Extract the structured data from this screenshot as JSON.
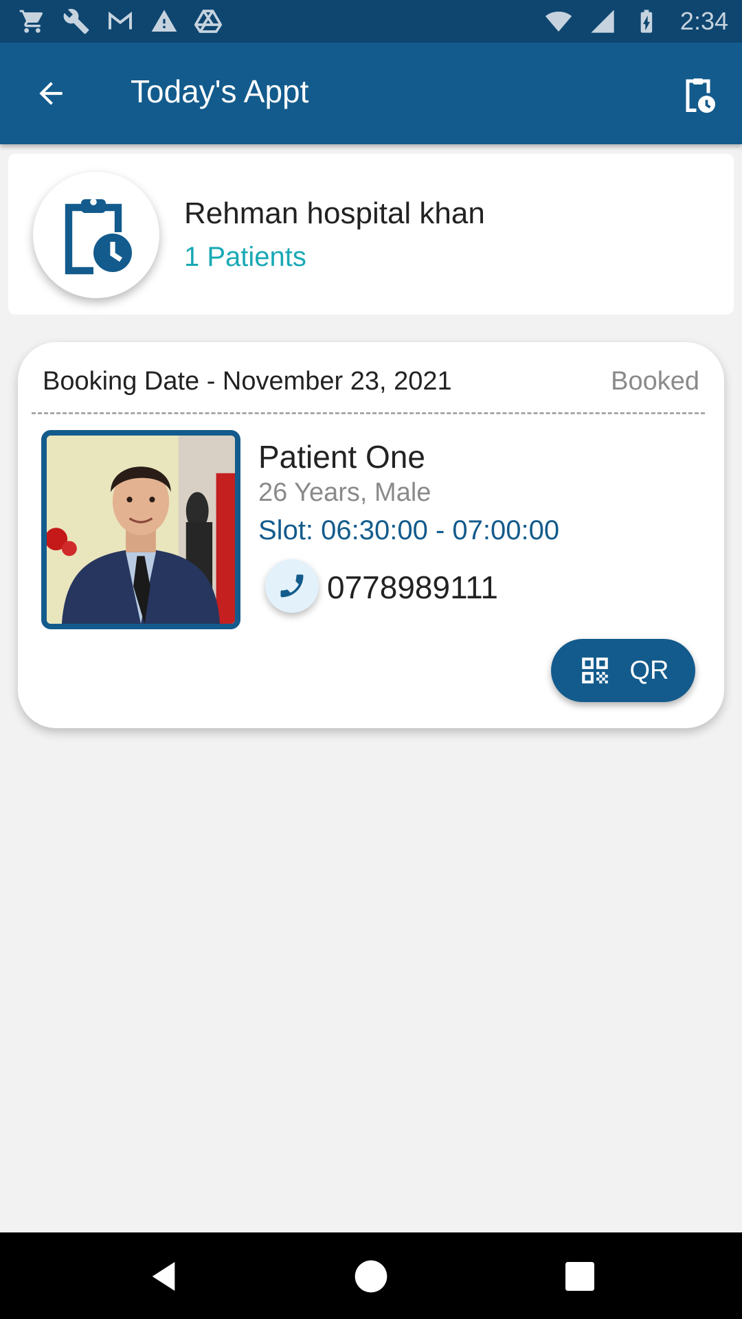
{
  "status_bar": {
    "time": "2:34",
    "left_icons": [
      "cart-icon",
      "wrench-icon",
      "gmail-icon",
      "warning-icon",
      "drive-icon"
    ],
    "right_icons": [
      "wifi-icon",
      "signal-icon",
      "battery-icon"
    ]
  },
  "app_bar": {
    "title": "Today's Appt",
    "back_icon": "arrow-back-icon",
    "action_icon": "clipboard-clock-icon"
  },
  "hospital": {
    "name": "Rehman hospital khan",
    "patients_count": "1 Patients",
    "icon": "clipboard-clock-icon"
  },
  "appointment": {
    "booking_date": "Booking Date - November 23, 2021",
    "status": "Booked",
    "patient_name": "Patient One",
    "patient_meta": "26 Years, Male",
    "slot": "Slot: 06:30:00 - 07:00:00",
    "phone": "0778989111",
    "qr_label": "QR"
  },
  "colors": {
    "status_bar": "#0e4670",
    "app_bar": "#135b8c",
    "accent_teal": "#18a9b5",
    "background": "#f2f2f2"
  },
  "nav_bar": {
    "icons": [
      "nav-back-icon",
      "nav-home-icon",
      "nav-recents-icon"
    ]
  }
}
